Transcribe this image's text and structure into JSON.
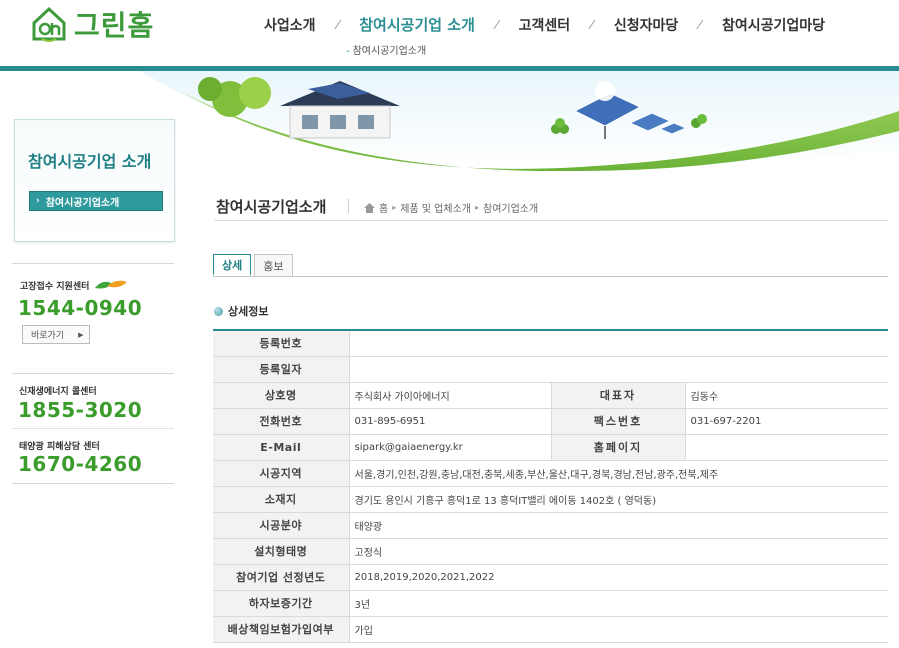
{
  "brand": {
    "name": "그린홈",
    "color": "#3d9a3a"
  },
  "accent": "#2a8c90",
  "gnb": {
    "items": [
      "사업소개",
      "참여시공기업 소개",
      "고객센터",
      "신청자마당",
      "참여시공기업마당"
    ],
    "sub_item": "참여시공기업소개"
  },
  "sidebar": {
    "title": "참여시공기업 소개",
    "menu_item": "참여시공기업소개",
    "support": {
      "label": "고장접수 지원센터",
      "phone": "1544-0940",
      "go_label": "바로가기"
    },
    "call_center": {
      "label": "신재생에너지 콜센터",
      "phone": "1855-3020"
    },
    "damage_center": {
      "label": "태양광 피해상담 센터",
      "phone": "1670-4260"
    }
  },
  "content": {
    "page_title": "참여시공기업소개",
    "breadcrumb": [
      "홈",
      "제품 및 업체소개",
      "참여기업소개"
    ],
    "tabs": [
      "상세",
      "홍보"
    ],
    "section_title": "상세정보"
  },
  "details": {
    "reg_no": {
      "label": "등록번호",
      "value": ""
    },
    "reg_date": {
      "label": "등록일자",
      "value": ""
    },
    "company": {
      "label": "상호명",
      "value": "주식회사 가이아에너지"
    },
    "ceo": {
      "label": "대표자",
      "value": "김동수"
    },
    "phone": {
      "label": "전화번호",
      "value": "031-895-6951"
    },
    "fax": {
      "label": "팩스번호",
      "value": "031-697-2201"
    },
    "email": {
      "label": "E-Mail",
      "value": "sipark@gaiaenergy.kr"
    },
    "homepage": {
      "label": "홈페이지",
      "value": ""
    },
    "region": {
      "label": "시공지역",
      "value": "서울,경기,인천,강원,충남,대전,충북,세종,부산,울산,대구,경북,경남,전남,광주,전북,제주"
    },
    "address": {
      "label": "소재지",
      "value": "경기도 용인시 기흥구 흥덕1로 13 흥덕IT밸리 에이동 1402호 ( 영덕동)"
    },
    "field": {
      "label": "시공분야",
      "value": "태양광"
    },
    "install_type": {
      "label": "설치형태명",
      "value": "고정식"
    },
    "years": {
      "label": "참여기업 선정년도",
      "value": "2018,2019,2020,2021,2022"
    },
    "warranty": {
      "label": "하자보증기간",
      "value": "3년"
    },
    "insurance": {
      "label": "배상책임보험가입여부",
      "value": "가입"
    }
  }
}
